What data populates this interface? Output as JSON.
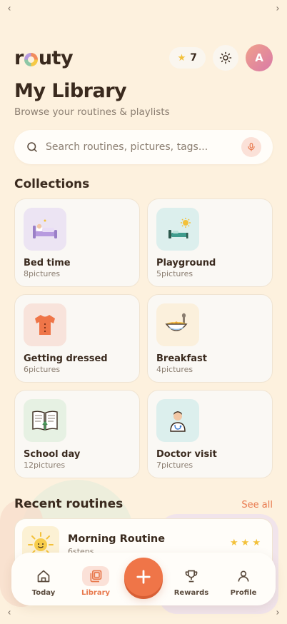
{
  "app": {
    "logo_left": "r",
    "logo_right": "uty"
  },
  "header": {
    "stars": "7",
    "avatar_initial": "A"
  },
  "page": {
    "title": "My Library",
    "subtitle": "Browse your routines & playlists"
  },
  "search": {
    "placeholder": "Search routines, pictures, tags..."
  },
  "collections": {
    "title": "Collections",
    "items": [
      {
        "name": "Bed time",
        "count": "8pictures",
        "tile_color": "#ece4f3"
      },
      {
        "name": "Playground",
        "count": "5pictures",
        "tile_color": "#dcefed"
      },
      {
        "name": "Getting dressed",
        "count": "6pictures",
        "tile_color": "#f8e3db"
      },
      {
        "name": "Breakfast",
        "count": "4pictures",
        "tile_color": "#fbf0dc"
      },
      {
        "name": "School day",
        "count": "12pictures",
        "tile_color": "#e6f1e3"
      },
      {
        "name": "Doctor visit",
        "count": "7pictures",
        "tile_color": "#dcefed"
      }
    ]
  },
  "recent": {
    "title": "Recent routines",
    "see_all": "See all",
    "items": [
      {
        "name": "Morning Routine",
        "steps": "6steps",
        "stars": "★★★"
      }
    ]
  },
  "tabs": [
    {
      "label": "Today",
      "icon": "home-icon"
    },
    {
      "label": "Library",
      "icon": "library-icon",
      "active": true
    },
    {
      "label": "Rewards",
      "icon": "trophy-icon"
    },
    {
      "label": "Profile",
      "icon": "person-icon"
    }
  ],
  "colors": {
    "accent": "#ef7548",
    "background": "#fdf1de",
    "star": "#f3c13a"
  }
}
